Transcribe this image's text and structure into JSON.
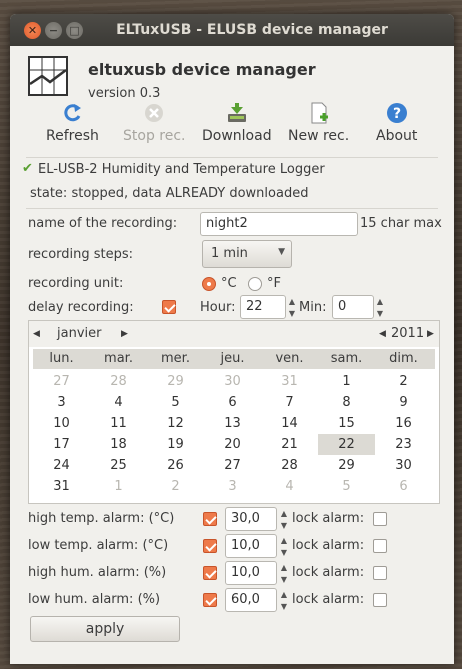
{
  "window": {
    "title": "ELTuxUSB - ELUSB device manager"
  },
  "app": {
    "title": "eltuxusb device manager",
    "version": "version 0.3"
  },
  "toolbar": {
    "refresh": "Refresh",
    "stop": "Stop rec.",
    "download": "Download",
    "new": "New rec.",
    "about": "About"
  },
  "status": {
    "device": "EL-USB-2 Humidity and Temperature Logger",
    "state": "state: stopped, data ALREADY downloaded"
  },
  "form": {
    "name_label": "name of the recording:",
    "name_value": "night2",
    "name_hint": "15 char max",
    "steps_label": "recording steps:",
    "steps_value": "1 min",
    "unit_label": "recording unit:",
    "unit_c": "°C",
    "unit_f": "°F",
    "delay_label": "delay recording:",
    "hour_label": "Hour:",
    "hour_value": "22",
    "min_label": "Min:",
    "min_value": "0"
  },
  "calendar": {
    "month": "janvier",
    "year": "2011",
    "weekdays": [
      "lun.",
      "mar.",
      "mer.",
      "jeu.",
      "ven.",
      "sam.",
      "dim."
    ],
    "weeks": [
      [
        "27",
        "28",
        "29",
        "30",
        "31",
        "1",
        "2"
      ],
      [
        "3",
        "4",
        "5",
        "6",
        "7",
        "8",
        "9"
      ],
      [
        "10",
        "11",
        "12",
        "13",
        "14",
        "15",
        "16"
      ],
      [
        "17",
        "18",
        "19",
        "20",
        "21",
        "22",
        "23"
      ],
      [
        "24",
        "25",
        "26",
        "27",
        "28",
        "29",
        "30"
      ],
      [
        "31",
        "1",
        "2",
        "3",
        "4",
        "5",
        "6"
      ]
    ],
    "selected": "22"
  },
  "alarms": {
    "high_temp_label": "high temp. alarm: (°C)",
    "high_temp_value": "30,0",
    "low_temp_label": "low  temp. alarm: (°C)",
    "low_temp_value": "10,0",
    "high_hum_label": "high hum. alarm: (%)",
    "high_hum_value": "10,0",
    "low_hum_label": "low  hum. alarm: (%)",
    "low_hum_value": "60,0",
    "lock_label": "lock alarm:"
  },
  "apply_label": "apply",
  "colors": {
    "accent": "#ee7a4a",
    "titlebar": "#3f3e3a",
    "window_bg": "#f1f0ec"
  }
}
